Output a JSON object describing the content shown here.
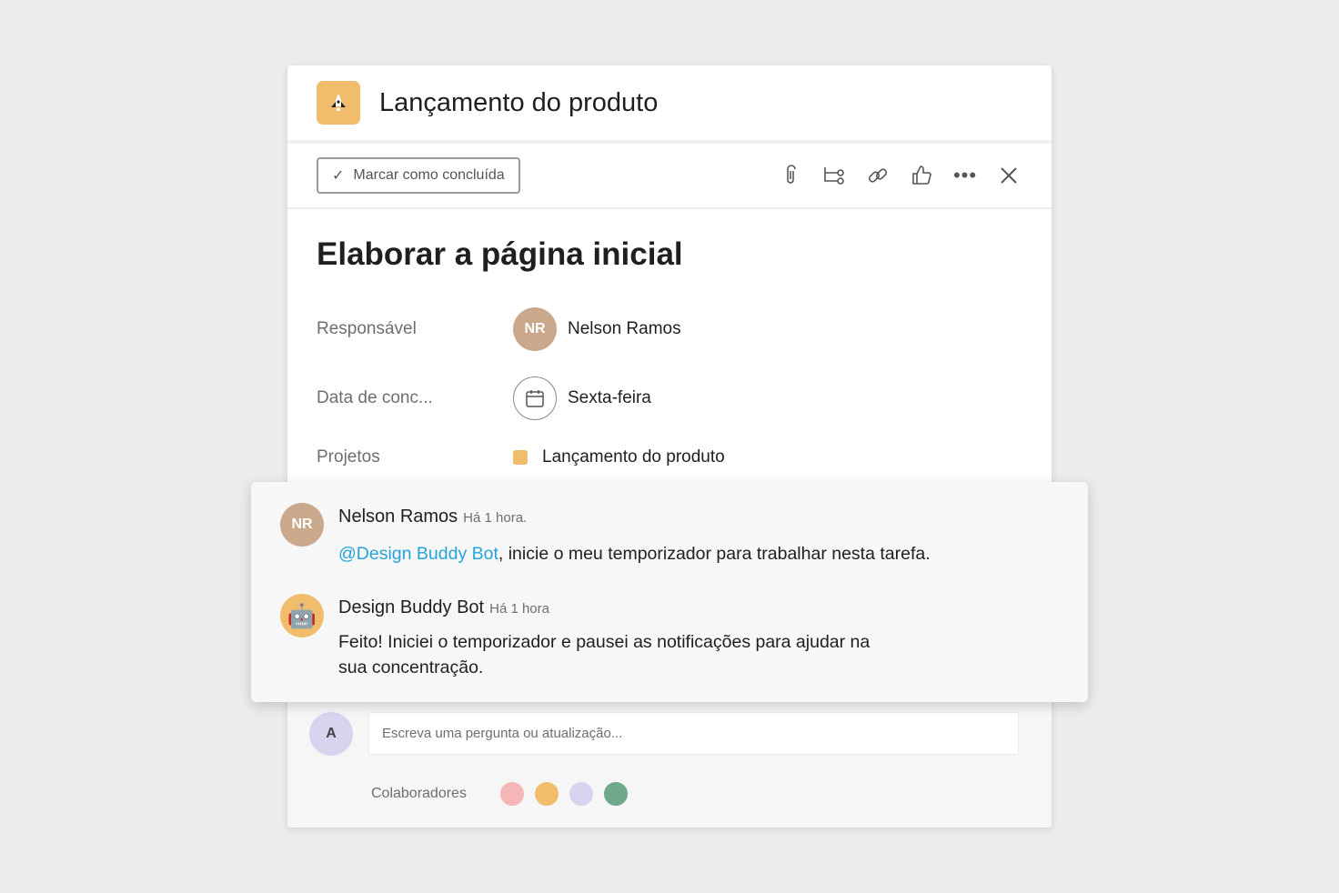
{
  "project": {
    "title": "Lançamento do produto",
    "icon": "rocket-icon",
    "color": "#f1bd6c"
  },
  "toolbar": {
    "mark_complete": "Marcar como concluída",
    "icons": [
      "paperclip-icon",
      "subtask-icon",
      "link-icon",
      "thumbs-up-icon",
      "more-icon",
      "close-icon"
    ]
  },
  "task": {
    "title": "Elaborar a página inicial",
    "fields": {
      "assignee_label": "Responsável",
      "assignee": "Nelson Ramos",
      "due_label": "Data de conc...",
      "due": "Sexta-feira",
      "projects_label": "Projetos",
      "project": "Lançamento do produto"
    }
  },
  "comments": [
    {
      "author": "Nelson Ramos",
      "time": "Há 1 hora.",
      "mention": "@Design Buddy Bot",
      "text": ", inicie o meu temporizador para trabalhar nesta tarefa."
    },
    {
      "author": "Design Buddy Bot",
      "time": "Há 1 hora",
      "text": "Feito! Iniciei o temporizador e pausei as notificações para ajudar na",
      "text2": "sua concentração."
    }
  ],
  "composer": {
    "placeholder": "Escreva uma pergunta ou atualização..."
  },
  "collaborators": {
    "label": "Colaboradores",
    "colors": [
      "#f4b6b6",
      "#f1bd6c",
      "#d9d3f0",
      "#6fa88a"
    ]
  }
}
